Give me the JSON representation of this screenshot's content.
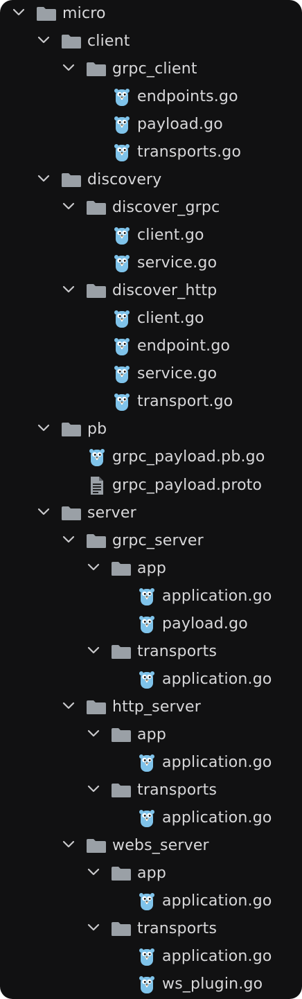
{
  "tree": [
    {
      "depth": 0,
      "type": "folder",
      "expanded": true,
      "label": "micro"
    },
    {
      "depth": 1,
      "type": "folder",
      "expanded": true,
      "label": "client"
    },
    {
      "depth": 2,
      "type": "folder",
      "expanded": true,
      "label": "grpc_client"
    },
    {
      "depth": 3,
      "type": "go",
      "label": "endpoints.go"
    },
    {
      "depth": 3,
      "type": "go",
      "label": "payload.go"
    },
    {
      "depth": 3,
      "type": "go",
      "label": "transports.go"
    },
    {
      "depth": 1,
      "type": "folder",
      "expanded": true,
      "label": "discovery"
    },
    {
      "depth": 2,
      "type": "folder",
      "expanded": true,
      "label": "discover_grpc"
    },
    {
      "depth": 3,
      "type": "go",
      "label": "client.go"
    },
    {
      "depth": 3,
      "type": "go",
      "label": "service.go"
    },
    {
      "depth": 2,
      "type": "folder",
      "expanded": true,
      "label": "discover_http"
    },
    {
      "depth": 3,
      "type": "go",
      "label": "client.go"
    },
    {
      "depth": 3,
      "type": "go",
      "label": "endpoint.go"
    },
    {
      "depth": 3,
      "type": "go",
      "label": "service.go"
    },
    {
      "depth": 3,
      "type": "go",
      "label": "transport.go"
    },
    {
      "depth": 1,
      "type": "folder",
      "expanded": true,
      "label": "pb"
    },
    {
      "depth": 2,
      "type": "go",
      "label": "grpc_payload.pb.go"
    },
    {
      "depth": 2,
      "type": "file",
      "label": "grpc_payload.proto"
    },
    {
      "depth": 1,
      "type": "folder",
      "expanded": true,
      "label": "server"
    },
    {
      "depth": 2,
      "type": "folder",
      "expanded": true,
      "label": "grpc_server"
    },
    {
      "depth": 3,
      "type": "folder",
      "expanded": true,
      "label": "app"
    },
    {
      "depth": 4,
      "type": "go",
      "label": "application.go"
    },
    {
      "depth": 4,
      "type": "go",
      "label": "payload.go"
    },
    {
      "depth": 3,
      "type": "folder",
      "expanded": true,
      "label": "transports"
    },
    {
      "depth": 4,
      "type": "go",
      "label": "application.go"
    },
    {
      "depth": 2,
      "type": "folder",
      "expanded": true,
      "label": "http_server"
    },
    {
      "depth": 3,
      "type": "folder",
      "expanded": true,
      "label": "app"
    },
    {
      "depth": 4,
      "type": "go",
      "label": "application.go"
    },
    {
      "depth": 3,
      "type": "folder",
      "expanded": true,
      "label": "transports"
    },
    {
      "depth": 4,
      "type": "go",
      "label": "application.go"
    },
    {
      "depth": 2,
      "type": "folder",
      "expanded": true,
      "label": "webs_server"
    },
    {
      "depth": 3,
      "type": "folder",
      "expanded": true,
      "label": "app"
    },
    {
      "depth": 4,
      "type": "go",
      "label": "application.go"
    },
    {
      "depth": 3,
      "type": "folder",
      "expanded": true,
      "label": "transports"
    },
    {
      "depth": 4,
      "type": "go",
      "label": "application.go"
    },
    {
      "depth": 4,
      "type": "go",
      "label": "ws_plugin.go"
    }
  ],
  "colors": {
    "background": "#111112",
    "text": "#d8d8da",
    "chevron": "#c9c9cc",
    "folder": "#9aa0a6",
    "gopher": "#7fc3ea",
    "file": "#9aa0a6"
  },
  "icons": {
    "folder": "folder-icon",
    "go": "go-gopher-icon",
    "file": "text-file-icon",
    "chevron": "chevron-down-icon"
  }
}
